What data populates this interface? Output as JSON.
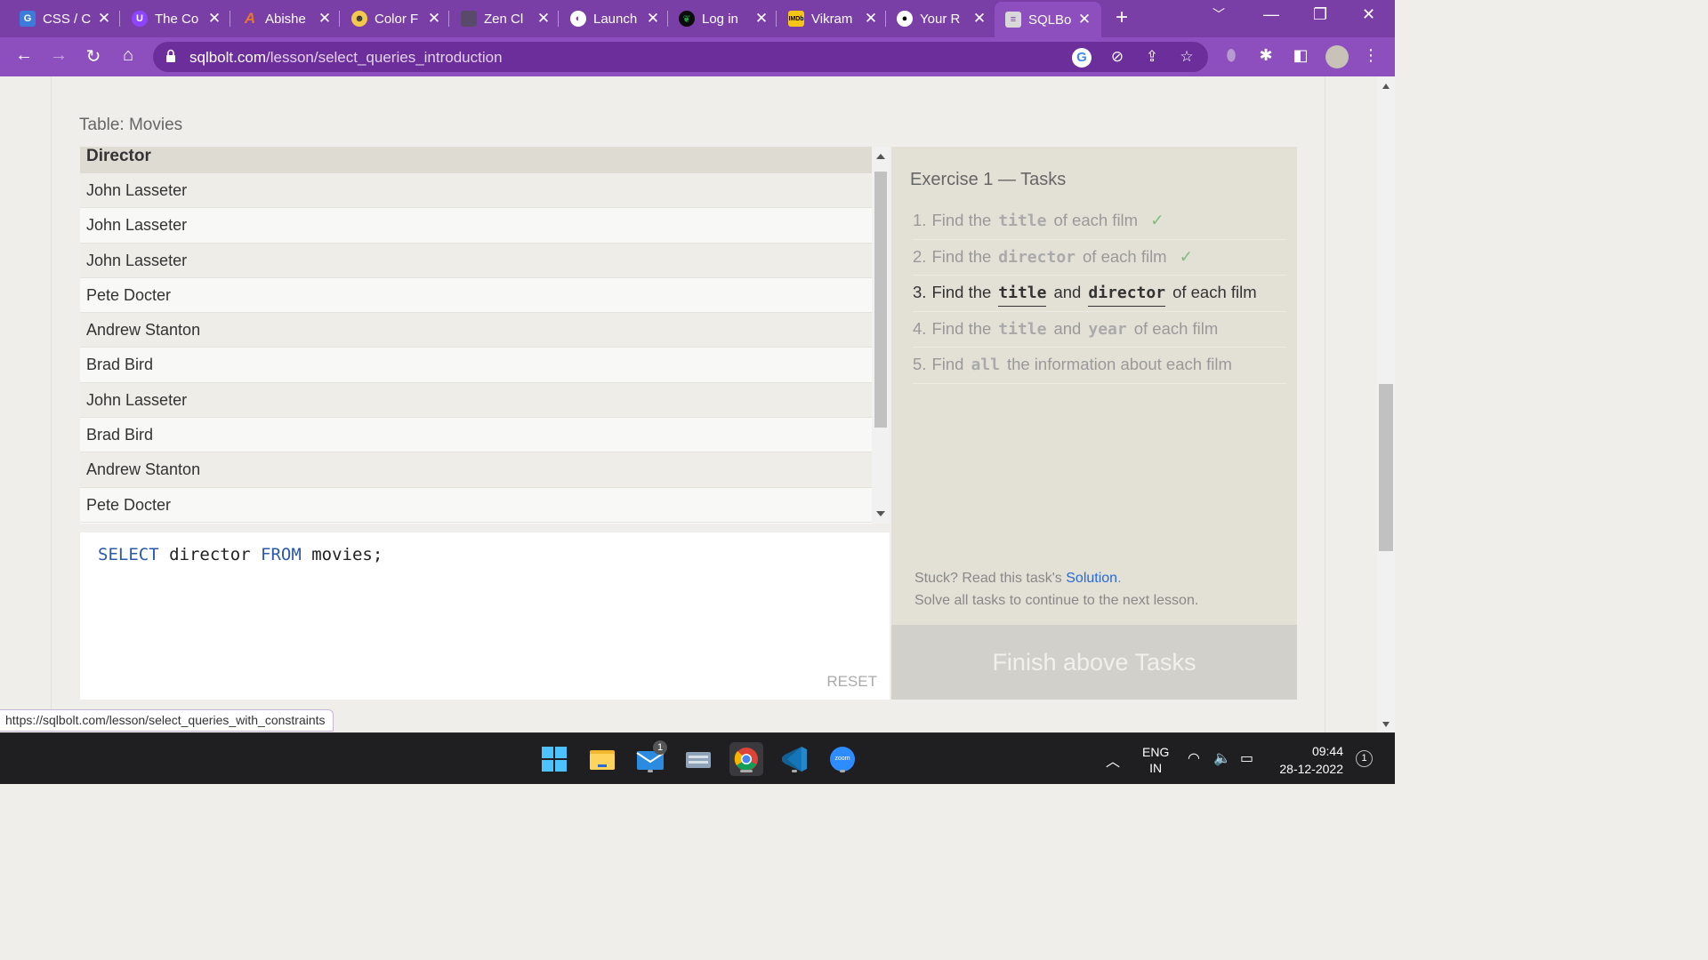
{
  "browser": {
    "tabs": [
      {
        "title": "CSS / C",
        "icon": "css-tab-icon",
        "color": "#3b7bd9"
      },
      {
        "title": "The Co",
        "icon": "u-tab-icon",
        "color": "#8e44ff"
      },
      {
        "title": "Abishe",
        "icon": "a-tab-icon",
        "color": "#e8772e"
      },
      {
        "title": "Color F",
        "icon": "color-tab-icon",
        "color": "#f2c94c"
      },
      {
        "title": "Zen Cl",
        "icon": "zen-tab-icon",
        "color": "#5a4a6a"
      },
      {
        "title": "Launch",
        "icon": "globe-tab-icon",
        "color": "#ffffff"
      },
      {
        "title": "Log in",
        "icon": "mongodb-tab-icon",
        "color": "#1d9e47"
      },
      {
        "title": "Vikram",
        "icon": "imdb-tab-icon",
        "color": "#f5c518"
      },
      {
        "title": "Your R",
        "icon": "github-tab-icon",
        "color": "#ffffff"
      },
      {
        "title": "SQLBo",
        "icon": "database-tab-icon",
        "color": "#d8d8d8"
      }
    ],
    "url_host": "sqlbolt.com",
    "url_path": "/lesson/select_queries_introduction"
  },
  "page": {
    "table_caption": "Table: Movies",
    "results": {
      "column": "Director",
      "rows": [
        "John Lasseter",
        "John Lasseter",
        "John Lasseter",
        "Pete Docter",
        "Andrew Stanton",
        "Brad Bird",
        "John Lasseter",
        "Brad Bird",
        "Andrew Stanton",
        "Pete Docter"
      ]
    },
    "editor": {
      "kw_select": "SELECT",
      "col": " director ",
      "kw_from": "FROM",
      "rest": " movies;",
      "reset_label": "RESET"
    },
    "exercise": {
      "title": "Exercise 1 — Tasks",
      "tasks": [
        {
          "num": "1.",
          "a": "Find the",
          "c1": "title",
          "b": "of each film",
          "c2": "",
          "d": "",
          "check": "✓"
        },
        {
          "num": "2.",
          "a": "Find the",
          "c1": "director",
          "b": "of each film",
          "c2": "",
          "d": "",
          "check": "✓"
        },
        {
          "num": "3.",
          "a": "Find the",
          "c1": "title",
          "b": "and",
          "c2": "director",
          "d": "of each film",
          "check": ""
        },
        {
          "num": "4.",
          "a": "Find the",
          "c1": "title",
          "b": "and",
          "c2": "year",
          "d": "of each film",
          "check": ""
        },
        {
          "num": "5.",
          "a": "Find",
          "c1": "all",
          "b": "the information about each film",
          "c2": "",
          "d": "",
          "check": ""
        }
      ],
      "help_prefix": "Stuck? Read this task's ",
      "help_link": "Solution",
      "help_suffix": ".",
      "help_line2": "Solve all tasks to continue to the next lesson.",
      "finish_label": "Finish above Tasks"
    },
    "status_url": "https://sqlbolt.com/lesson/select_queries_with_constraints"
  },
  "taskbar": {
    "lang": "ENG",
    "region": "IN",
    "time": "09:44",
    "date": "28-12-2022",
    "notification_count": "1",
    "mail_badge": "1",
    "zoom_label": "zoom"
  }
}
